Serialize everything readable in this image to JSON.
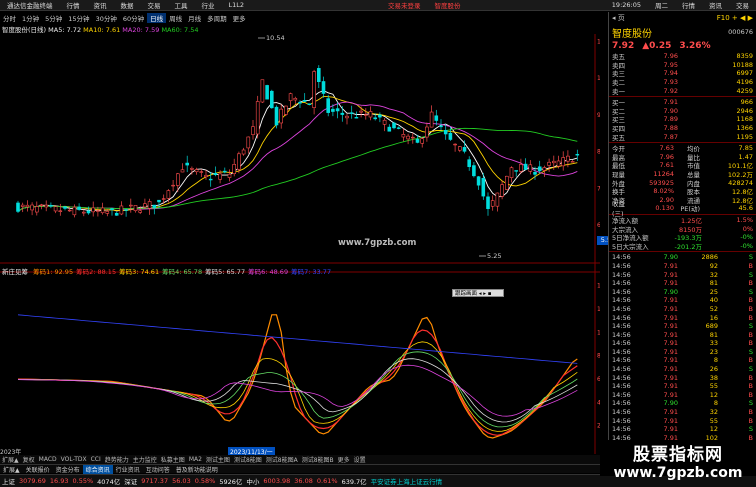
{
  "topbar": {
    "items": [
      "通达信金融终端",
      "行情",
      "资讯",
      "数据",
      "交易",
      "工具",
      "行业",
      "L1L2"
    ],
    "center_items": [
      "交易未登录",
      "智度股份"
    ],
    "time": "19:26:05",
    "right_items": [
      "周二",
      "行情",
      "资讯",
      "交易"
    ]
  },
  "periods": [
    "分时",
    "1分钟",
    "5分钟",
    "15分钟",
    "30分钟",
    "60分钟",
    "日线",
    "周线",
    "月线",
    "多周期",
    "更多"
  ],
  "active_period": "日线",
  "ma_legend": {
    "title": "智度股份(日线)",
    "ma5": "MA5: 7.72",
    "ma10": "MA10: 7.61",
    "ma20": "MA20: 7.59",
    "ma60": "MA60: 7.54"
  },
  "annotations": {
    "high": "10.54",
    "low": "5.25",
    "watermark": "www.7gpzb.com",
    "price_tag": "5.52",
    "date_tag": "2023/11/13/一",
    "year_tag": "2023年",
    "tooltip": "跟踪画面 ◂ ▸ ▪"
  },
  "price_axis": [
    "11.00",
    "10.00",
    "9.00",
    "8.00",
    "7.00",
    "6.00"
  ],
  "ind_axis": [
    "140.00",
    "120.00",
    "100.00",
    "80.00",
    "60.00",
    "40.00",
    "20.00"
  ],
  "ind_legend": {
    "title": "新庄见筹",
    "items": [
      {
        "label": "筹码1: 92.95",
        "color": "#ff8c00"
      },
      {
        "label": "筹码2: 88.15",
        "color": "#ff3030"
      },
      {
        "label": "筹码3: 74.61",
        "color": "#ffd400"
      },
      {
        "label": "筹码4: 65.78",
        "color": "#66dd66"
      },
      {
        "label": "筹码5: 65.77",
        "color": "#dddddd"
      },
      {
        "label": "筹码6: 48.69",
        "color": "#dd44dd"
      },
      {
        "label": "筹码7: 33.77",
        "color": "#3344ff"
      }
    ]
  },
  "tools_tabs": [
    "扩展▲",
    "复权",
    "MACD",
    "VOL-TDX",
    "CCI",
    "趋势能力",
    "主力监控",
    "私募主图",
    "MA2",
    "测试主图",
    "测试8能图",
    "测试8能图A",
    "测试8能图B",
    "更多",
    "设置"
  ],
  "bottom_tabs": [
    "扩展▲",
    "关联报价",
    "资金分布",
    "综合资讯",
    "行业资讯",
    "互动问答",
    "普及新功能说明"
  ],
  "bottom_tab_highlight": "综合资讯",
  "statusbar": {
    "sh_label": "上证",
    "sh_value": "3079.69",
    "sh_chg": "16.93",
    "sh_pct": "0.55%",
    "sh_amt": "4074亿",
    "sz_label": "深证",
    "sz_value": "9717.37",
    "sz_chg": "56.03",
    "sz_pct": "0.58%",
    "sz_amt": "5926亿",
    "zx_label": "中小",
    "zx_value": "6003.98",
    "zx_chg": "36.08",
    "zx_pct": "0.61%",
    "zx_amt": "639.7亿",
    "broker": "平安证券上海上证云行情"
  },
  "right_panel": {
    "header_left": "◂ 页",
    "header_right": "F10 + ◀ ▶",
    "name": "智度股份",
    "code": "000676",
    "price": "7.92",
    "change": "▲0.25",
    "change_pct": "3.26%",
    "sell_orders": [
      {
        "label": "卖五",
        "price": "7.96",
        "vol": "8359"
      },
      {
        "label": "卖四",
        "price": "7.95",
        "vol": "10188"
      },
      {
        "label": "卖三",
        "price": "7.94",
        "vol": "6997"
      },
      {
        "label": "卖二",
        "price": "7.93",
        "vol": "4196"
      },
      {
        "label": "卖一",
        "price": "7.92",
        "vol": "4259"
      }
    ],
    "buy_orders": [
      {
        "label": "买一",
        "price": "7.91",
        "vol": "966"
      },
      {
        "label": "买二",
        "price": "7.90",
        "vol": "2946"
      },
      {
        "label": "买三",
        "price": "7.89",
        "vol": "1168"
      },
      {
        "label": "买四",
        "price": "7.88",
        "vol": "1366"
      },
      {
        "label": "买五",
        "price": "7.87",
        "vol": "1195"
      }
    ],
    "stats": [
      {
        "k": "今开",
        "v": "7.63",
        "k2": "均价",
        "v2": "7.85"
      },
      {
        "k": "最高",
        "v": "7.96",
        "k2": "量比",
        "v2": "1.47"
      },
      {
        "k": "最低",
        "v": "7.61",
        "k2": "市值",
        "v2": "101.1亿"
      },
      {
        "k": "现量",
        "v": "11264",
        "k2": "总量",
        "v2": "102.2万"
      },
      {
        "k": "外盘",
        "v": "593925",
        "k2": "内盘",
        "v2": "428274"
      },
      {
        "k": "换手",
        "v": "8.02%",
        "k2": "股本",
        "v2": "12.8亿"
      },
      {
        "k": "净资",
        "v": "2.90",
        "k2": "流通",
        "v2": "12.8亿"
      },
      {
        "k": "收益(三)",
        "v": "0.130",
        "k2": "PE(动)",
        "v2": "45.6"
      }
    ],
    "flows": [
      {
        "k": "净流入额",
        "v": "1.25亿",
        "v2": "1.5%"
      },
      {
        "k": "大宗流入",
        "v": "8150万",
        "v2": "0%"
      },
      {
        "k": "5日净流入额",
        "v": "-193.3万",
        "v2": "-0%"
      },
      {
        "k": "5日大宗流入",
        "v": "-201.2万",
        "v2": "-0%"
      }
    ],
    "ticks": [
      {
        "t": "14:56",
        "p": "7.90",
        "v": "2886",
        "d": "S"
      },
      {
        "t": "14:56",
        "p": "7.91",
        "v": "92",
        "d": "B"
      },
      {
        "t": "14:56",
        "p": "7.91",
        "v": "32",
        "d": "S"
      },
      {
        "t": "14:56",
        "p": "7.91",
        "v": "81",
        "d": "B"
      },
      {
        "t": "14:56",
        "p": "7.90",
        "v": "25",
        "d": "S"
      },
      {
        "t": "14:56",
        "p": "7.91",
        "v": "40",
        "d": "B"
      },
      {
        "t": "14:56",
        "p": "7.91",
        "v": "52",
        "d": "B"
      },
      {
        "t": "14:56",
        "p": "7.91",
        "v": "16",
        "d": "B"
      },
      {
        "t": "14:56",
        "p": "7.91",
        "v": "689",
        "d": "S"
      },
      {
        "t": "14:56",
        "p": "7.91",
        "v": "81",
        "d": "B"
      },
      {
        "t": "14:56",
        "p": "7.91",
        "v": "33",
        "d": "B"
      },
      {
        "t": "14:56",
        "p": "7.91",
        "v": "23",
        "d": "S"
      },
      {
        "t": "14:56",
        "p": "7.91",
        "v": "8",
        "d": "B"
      },
      {
        "t": "14:56",
        "p": "7.91",
        "v": "26",
        "d": "S"
      },
      {
        "t": "14:56",
        "p": "7.91",
        "v": "38",
        "d": "B"
      },
      {
        "t": "14:56",
        "p": "7.91",
        "v": "55",
        "d": "B"
      },
      {
        "t": "14:56",
        "p": "7.91",
        "v": "12",
        "d": "B"
      },
      {
        "t": "14:56",
        "p": "7.90",
        "v": "8",
        "d": "S"
      },
      {
        "t": "14:56",
        "p": "7.91",
        "v": "32",
        "d": "B"
      },
      {
        "t": "14:56",
        "p": "7.91",
        "v": "55",
        "d": "B"
      },
      {
        "t": "14:56",
        "p": "7.91",
        "v": "12",
        "d": "S"
      },
      {
        "t": "14:56",
        "p": "7.91",
        "v": "102",
        "d": "B"
      },
      {
        "t": "14:56",
        "p": "7.91",
        "v": "8",
        "d": "B"
      }
    ]
  },
  "site_watermark": {
    "line1": "股票指标网",
    "line2": "www.7gpzb.com"
  },
  "colors": {
    "up": "#ff4d4d",
    "down": "#2ee02e",
    "ma5": "#ffffff",
    "ma10": "#ffd400",
    "ma20": "#dd44dd",
    "ma60": "#22cc22"
  }
}
